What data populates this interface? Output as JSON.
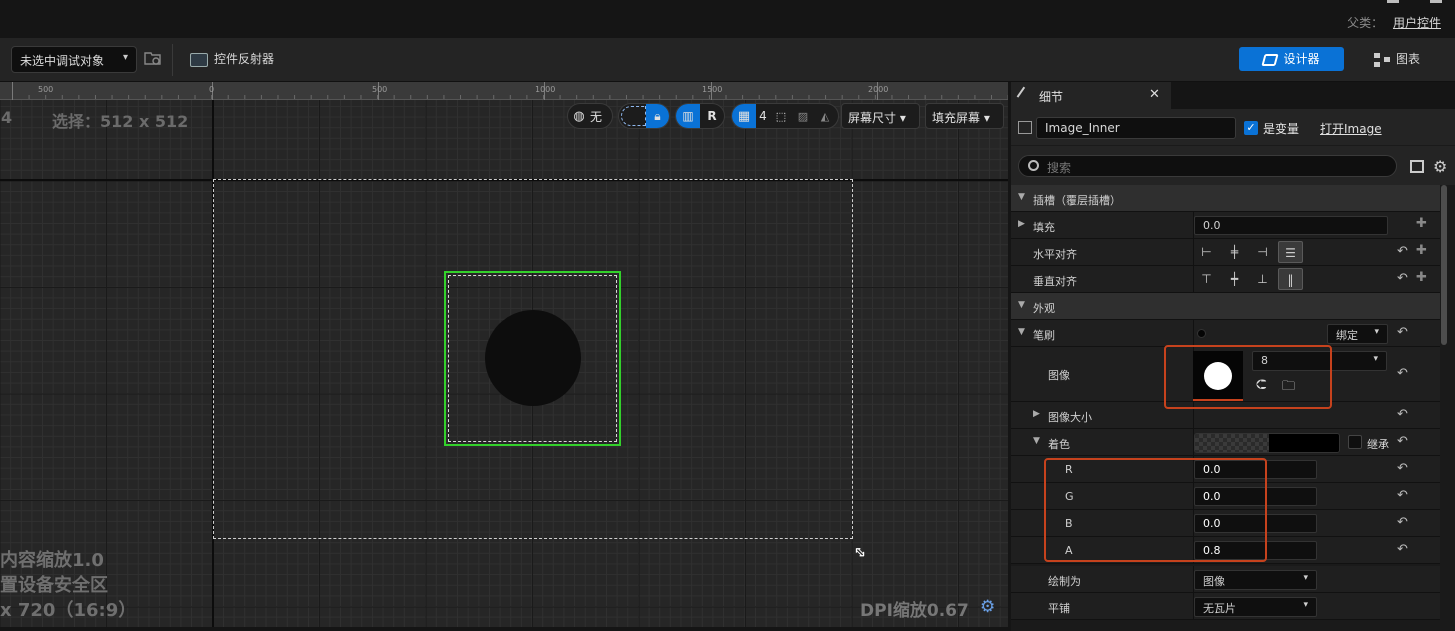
{
  "topbar": {
    "parent_label": "父类：",
    "parent_value": "用户控件"
  },
  "toolbar": {
    "debug_select": "未选中调试对象",
    "reflector": "控件反射器",
    "designer": "设计器",
    "graph": "图表"
  },
  "ruler": {
    "labels": [
      "500",
      "0",
      "500",
      "1000",
      "1500",
      "2000"
    ]
  },
  "viewport": {
    "selection_prefix": "4",
    "selection_info": "选择：512 x 512",
    "tools": {
      "localize": "无",
      "r_label": "R",
      "grid_value": "4",
      "screen_size": "屏幕尺寸",
      "fill_screen": "填充屏幕"
    },
    "overlay": {
      "line1": "内容缩放1.0",
      "line2": "置设备安全区",
      "line3": "x 720（16:9）"
    },
    "dpi": "DPI缩放0.67"
  },
  "panel": {
    "tab": "细节",
    "widget_name": "Image_Inner",
    "is_variable": "是变量",
    "open_asset": "打开Image",
    "search_placeholder": "搜索",
    "sections": {
      "slot": "插槽（覆层插槽）",
      "fill_label": "填充",
      "fill_value": "0.0",
      "h_align": "水平对齐",
      "v_align": "垂直对齐",
      "appearance": "外观",
      "brush": "笔刷",
      "bind": "绑定",
      "image": "图像",
      "image_value": "8",
      "image_size": "图像大小",
      "tint": "着色",
      "inherit": "继承",
      "r_label": "R",
      "r_value": "0.0",
      "g_label": "G",
      "g_value": "0.0",
      "b_label": "B",
      "b_value": "0.0",
      "a_label": "A",
      "a_value": "0.8",
      "draw_as": "绘制为",
      "draw_as_value": "图像",
      "tiling": "平铺",
      "tiling_value": "无瓦片"
    }
  },
  "colors": {
    "accent": "#0a72d6",
    "selection": "#33d12b",
    "highlight": "#c6421d"
  }
}
